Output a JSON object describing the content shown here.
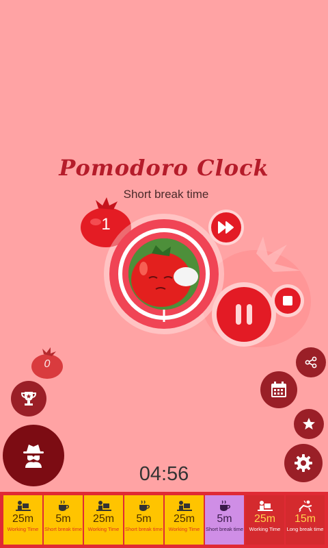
{
  "app": {
    "title": "Pomodoro Clock",
    "status": "Short break time"
  },
  "counters": {
    "completed_pomodoros": "1",
    "secondary_count": "0"
  },
  "timer": {
    "remaining": "04:56"
  },
  "controls": {
    "fast_forward_icon": "fast-forward-icon",
    "pause_icon": "pause-icon",
    "stop_icon": "stop-icon",
    "share_icon": "share-icon",
    "calendar_icon": "calendar-icon",
    "star_icon": "star-icon",
    "settings_icon": "gear-icon",
    "trophy_icon": "trophy-icon",
    "profile_icon": "spy-icon"
  },
  "schedule": [
    {
      "mins": "25m",
      "label": "Working Time",
      "kind": "work",
      "state": "done"
    },
    {
      "mins": "5m",
      "label": "Short break time",
      "kind": "break",
      "state": "done"
    },
    {
      "mins": "25m",
      "label": "Working Time",
      "kind": "work",
      "state": "done"
    },
    {
      "mins": "5m",
      "label": "Short break time",
      "kind": "break",
      "state": "done"
    },
    {
      "mins": "25m",
      "label": "Working Time",
      "kind": "work",
      "state": "done"
    },
    {
      "mins": "5m",
      "label": "Short break time",
      "kind": "break",
      "state": "current"
    },
    {
      "mins": "25m",
      "label": "Working Time",
      "kind": "work",
      "state": "upcoming"
    },
    {
      "mins": "15m",
      "label": "Long break time",
      "kind": "long-break",
      "state": "upcoming"
    }
  ],
  "colors": {
    "background": "#ffa3a4",
    "accent": "#e31b25",
    "done": "#ffc400",
    "current": "#cf8ee6",
    "upcoming": "#d42a2e"
  }
}
